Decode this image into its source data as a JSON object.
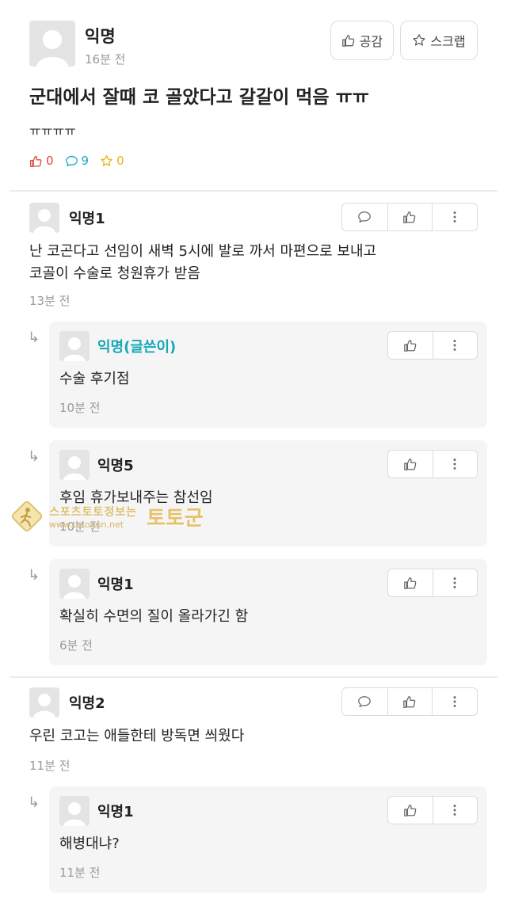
{
  "post": {
    "author": "익명",
    "time": "16분 전",
    "like_btn": "공감",
    "scrap_btn": "스크랩",
    "title": "군대에서 잘때 코 골았다고 갈갈이 먹음 ㅠㅠ",
    "body": "ㅠㅠㅠㅠ",
    "stats": {
      "likes": "0",
      "comments": "9",
      "scraps": "0"
    }
  },
  "comments": [
    {
      "author": "익명1",
      "text": "난 코곤다고 선임이 새벽 5시에 발로 까서 마편으로 보내고\n코골이 수술로 청원휴가 받음",
      "time": "13분 전",
      "replies": [
        {
          "author": "익명(글쓴이)",
          "text": "수술 후기점",
          "time": "10분 전"
        },
        {
          "author": "익명5",
          "text": "후임 휴가보내주는 참선임",
          "time": "10분 전"
        },
        {
          "author": "익명1",
          "text": "확실히 수면의 질이 올라가긴 함",
          "time": "6분 전"
        }
      ]
    },
    {
      "author": "익명2",
      "text": "우린 코고는 애들한테 방독면 씌웠다",
      "time": "11분 전",
      "replies": [
        {
          "author": "익명1",
          "text": "해병대냐?",
          "time": "11분 전"
        }
      ]
    }
  ],
  "watermark": {
    "line1": "스포츠토토정보는",
    "line2": "www.totogun.net",
    "brand": "토토군"
  },
  "colors": {
    "op_name": "#15a8b7",
    "like_stat": "#d64a3a",
    "comment_stat": "#1fa6c8",
    "scrap_stat": "#e5b416"
  }
}
